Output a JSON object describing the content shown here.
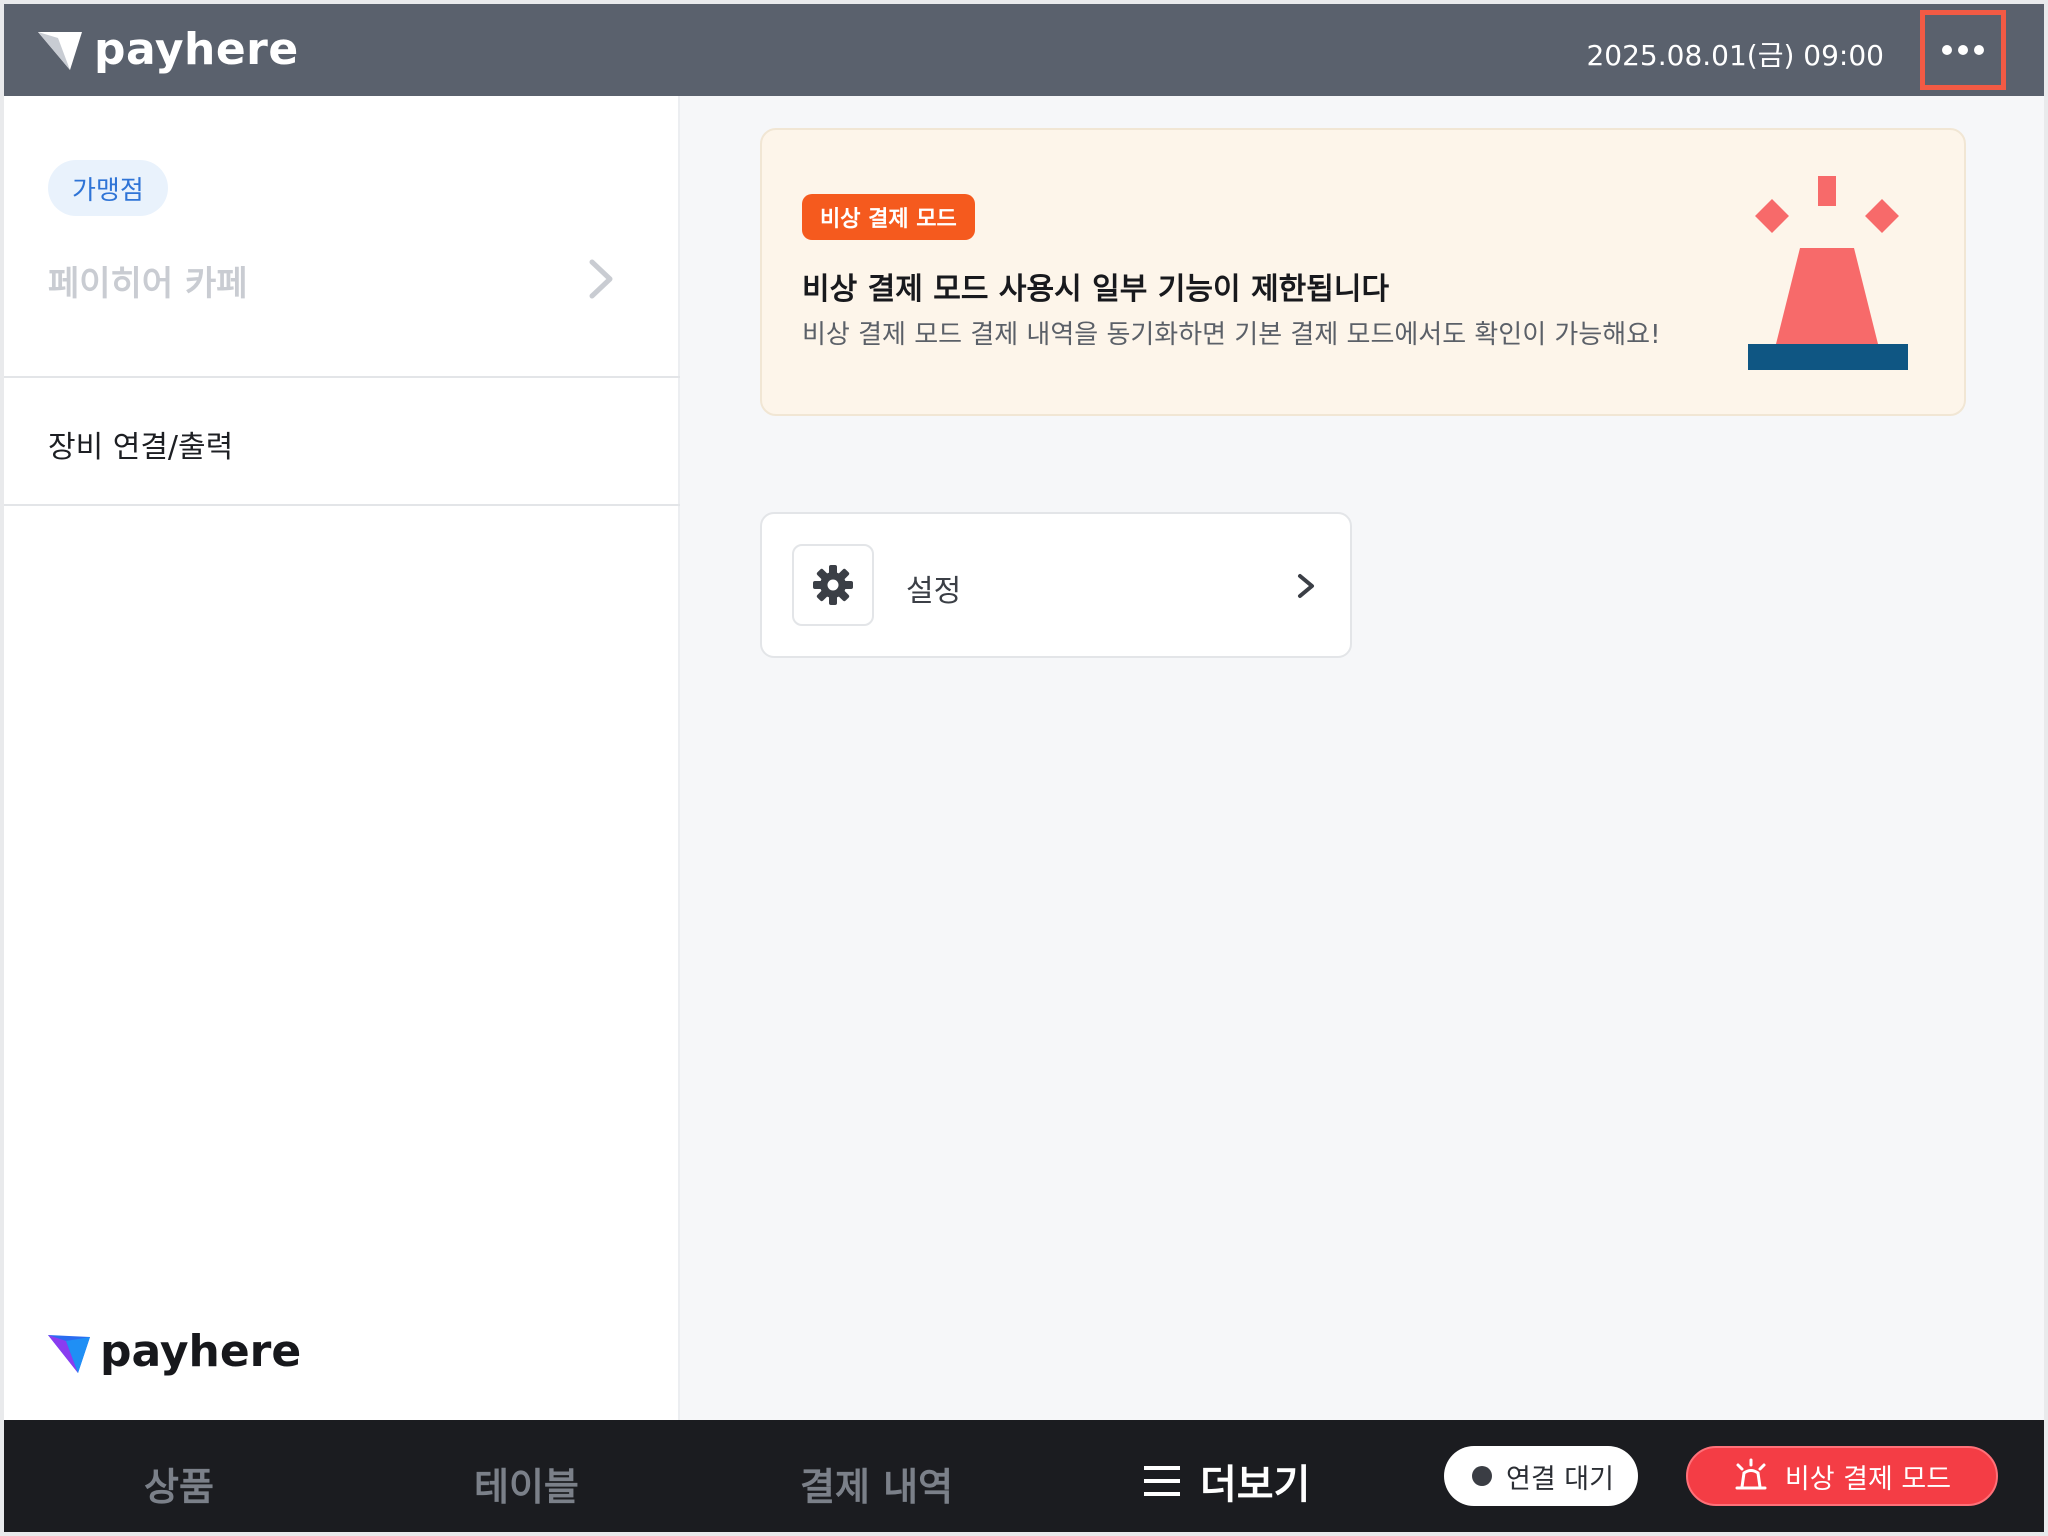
{
  "header": {
    "brand": "payhere",
    "datetime": "2025.08.01(금) 09:00",
    "more_icon": "more-horizontal-icon"
  },
  "sidebar": {
    "chip_label": "가맹점",
    "store_name": "페이히어 카페",
    "menu_items": [
      {
        "label": "장비 연결/출력"
      }
    ],
    "footer_logo": "payhere"
  },
  "banner": {
    "badge": "비상 결제 모드",
    "title": "비상 결제 모드 사용시 일부 기능이 제한됩니다",
    "subtitle": "비상 결제 모드 결제 내역을 동기화하면 기본 결제 모드에서도 확인이 가능해요!",
    "illustration": "siren-icon"
  },
  "settings_card": {
    "label": "설정",
    "icon": "gear-icon"
  },
  "bottom_nav": {
    "items": [
      {
        "label": "상품"
      },
      {
        "label": "테이블"
      },
      {
        "label": "결제 내역"
      }
    ],
    "more_label": "더보기",
    "connection_status": "연결 대기",
    "emergency_button": "비상 결제 모드"
  },
  "colors": {
    "header_bg": "#5a616d",
    "highlight_border": "#f25a44",
    "badge_orange": "#f55a1e",
    "siren_red": "#f76a6a",
    "siren_base": "#0f5683",
    "emergency_red": "#f43d45",
    "bottom_bg": "#1b1c20"
  }
}
